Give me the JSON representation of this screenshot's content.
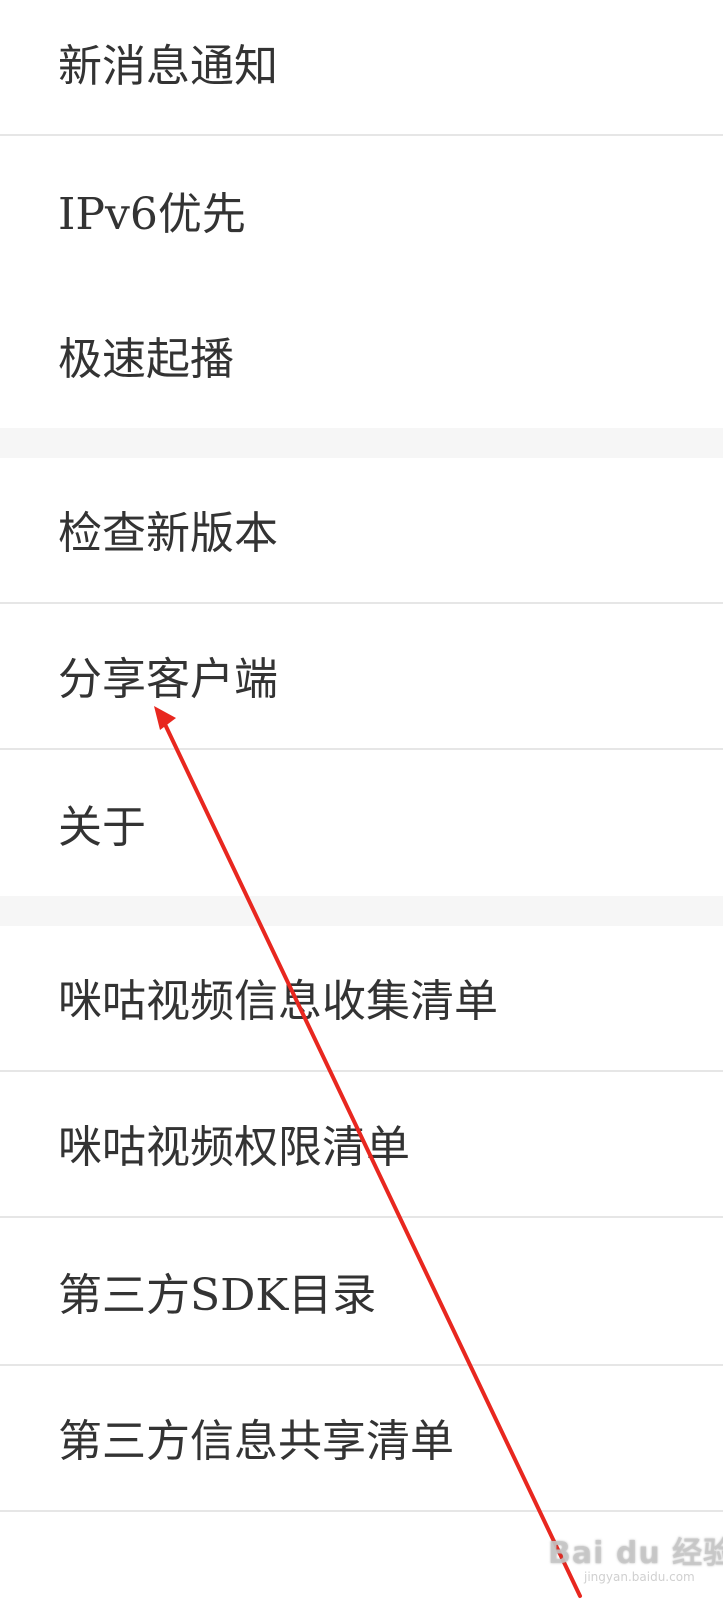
{
  "settings": {
    "items": [
      {
        "label": "新消息通知"
      },
      {
        "label": "IPv6优先"
      },
      {
        "label": "极速起播"
      },
      {
        "label": "检查新版本"
      },
      {
        "label": "分享客户端"
      },
      {
        "label": "关于"
      },
      {
        "label": "咪咕视频信息收集清单"
      },
      {
        "label": "咪咕视频权限清单"
      },
      {
        "label": "第三方SDK目录"
      },
      {
        "label": "第三方信息共享清单"
      }
    ]
  },
  "annotation": {
    "arrow_color": "#e8271f"
  },
  "watermark": {
    "main": "Bai du 经验",
    "sub": "jingyan.baidu.com"
  }
}
